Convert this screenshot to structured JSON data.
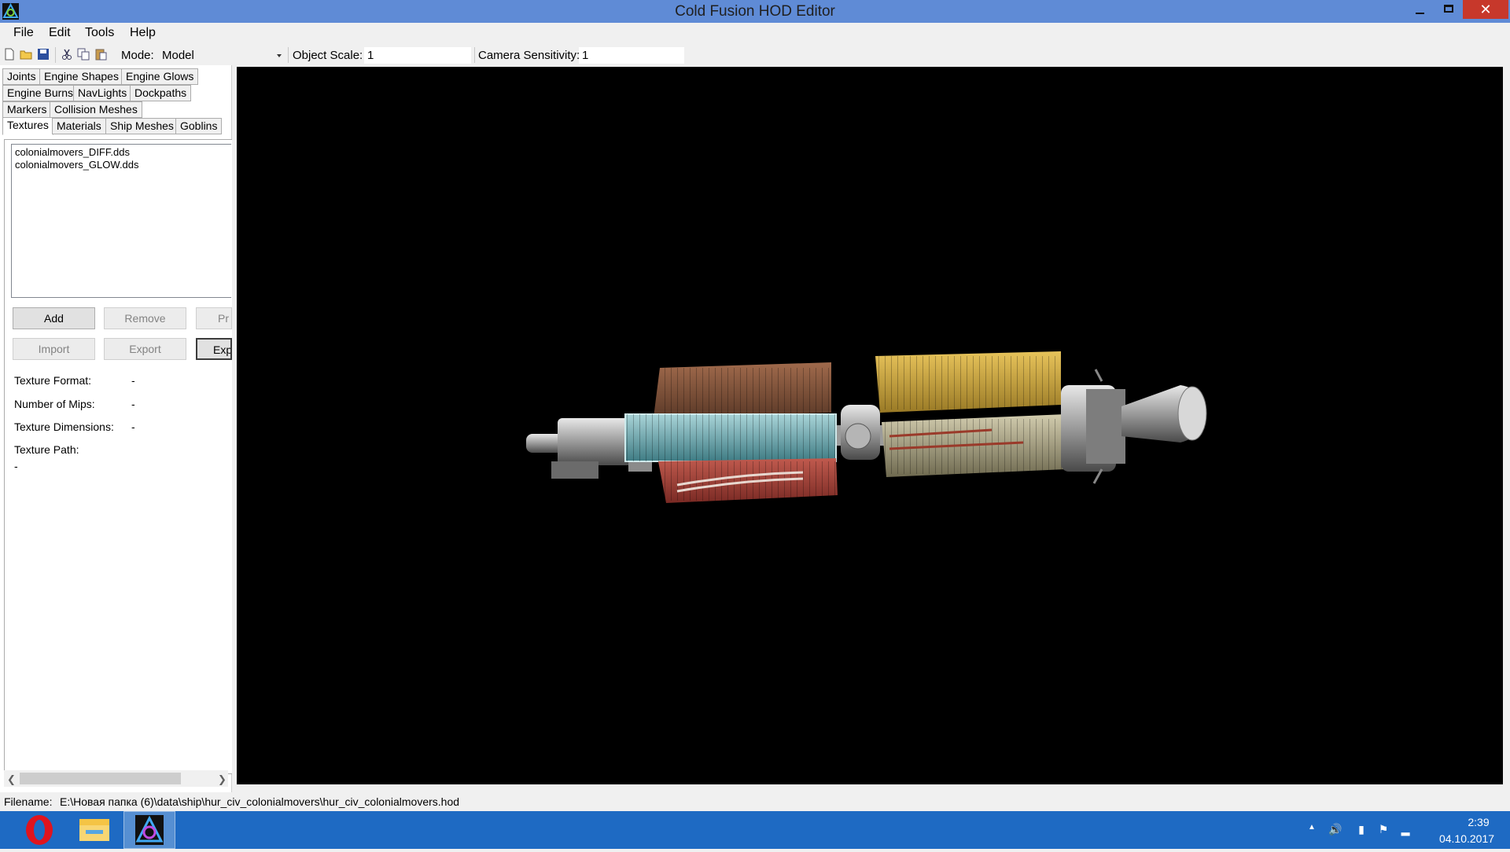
{
  "window": {
    "title": "Cold Fusion HOD Editor",
    "close_glyph": "✕"
  },
  "menu": {
    "file": "File",
    "edit": "Edit",
    "tools": "Tools",
    "help": "Help"
  },
  "toolbar": {
    "mode_label": "Mode:",
    "mode_value": "Model",
    "scale_label": "Object Scale:",
    "scale_value": "1",
    "sensitivity_label": "Camera Sensitivity:",
    "sensitivity_value": "1"
  },
  "tabs": {
    "joints": "Joints",
    "engine_shapes": "Engine Shapes",
    "engine_glows": "Engine Glows",
    "engine_burns": "Engine Burns",
    "navlights": "NavLights",
    "dockpaths": "Dockpaths",
    "markers": "Markers",
    "collision_meshes": "Collision Meshes",
    "textures": "Textures",
    "materials": "Materials",
    "ship_meshes": "Ship Meshes",
    "goblins": "Goblins"
  },
  "textures": {
    "items": [
      "colonialmovers_DIFF.dds",
      "colonialmovers_GLOW.dds"
    ],
    "buttons": {
      "add": "Add",
      "remove": "Remove",
      "preview": "Pr",
      "import": "Import",
      "export": "Export",
      "export_all": "Exp"
    },
    "format_label": "Texture Format:",
    "format_value": "-",
    "mips_label": "Number of Mips:",
    "mips_value": "-",
    "dimensions_label": "Texture Dimensions:",
    "dimensions_value": "-",
    "path_label": "Texture Path:",
    "path_value": "-"
  },
  "status": {
    "filename_label": "Filename:",
    "filename_value": "E:\\Новая папка (6)\\data\\ship\\hur_civ_colonialmovers\\hur_civ_colonialmovers.hod"
  },
  "taskbar": {
    "time": "2:39",
    "date": "04.10.2017"
  },
  "colors": {
    "titlebar": "#5f8bd6",
    "close": "#c7382b",
    "taskbar": "#1e6ac3",
    "viewport": "#000000"
  }
}
